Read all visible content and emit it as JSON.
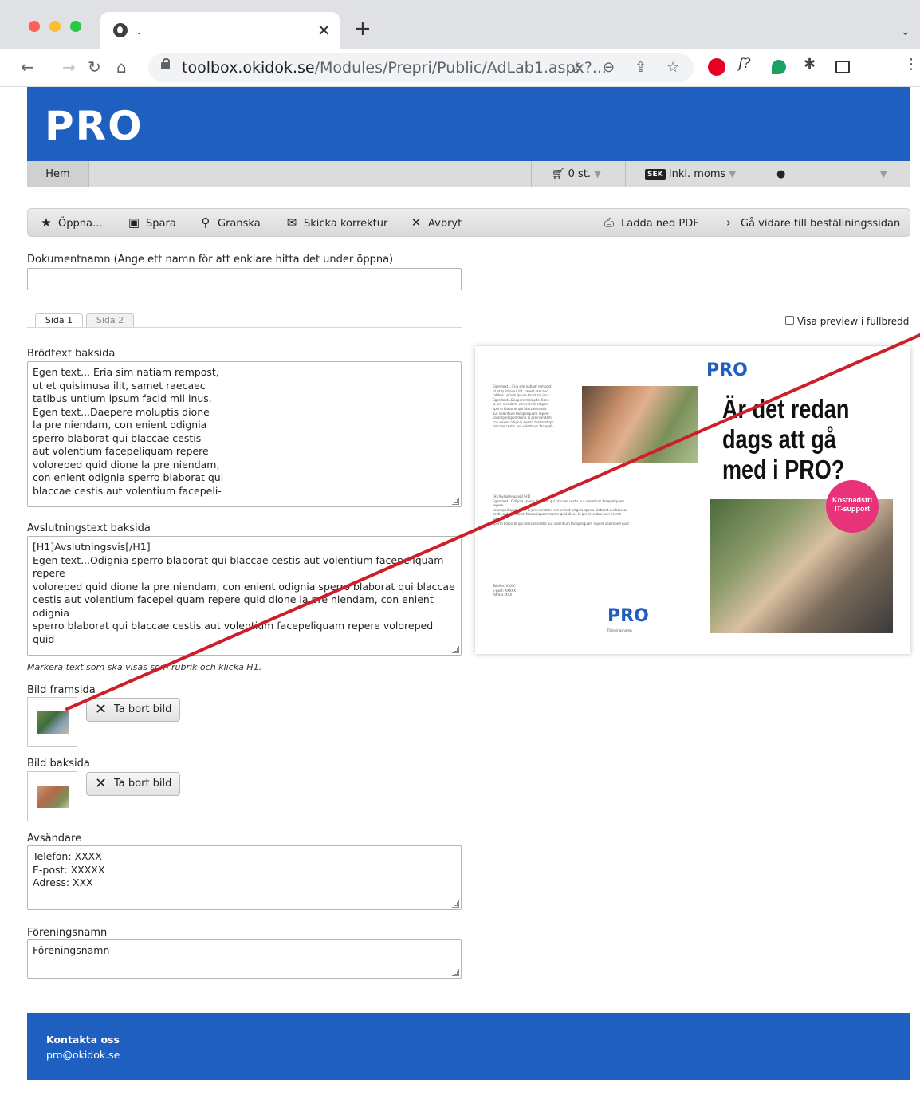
{
  "browser": {
    "tab_title": ".",
    "url_host": "toolbox.okidok.se",
    "url_path": "/Modules/Prepri/Public/AdLab1.aspx?..."
  },
  "header": {
    "logo": "PRO"
  },
  "menu": {
    "home": "Hem",
    "cart": "0 st.",
    "currency_badge": "SEK",
    "vat": "Inkl. moms"
  },
  "actions": {
    "open": "Öppna...",
    "save": "Spara",
    "review": "Granska",
    "send_proof": "Skicka korrektur",
    "cancel": "Avbryt",
    "download_pdf": "Ladda ned PDF",
    "go_order": "Gå vidare till beställningssidan"
  },
  "form": {
    "doc_name_label": "Dokumentnamn (Ange ett namn för att enklare hitta det under öppna)",
    "doc_name_value": "",
    "tabs": [
      "Sida 1",
      "Sida 2"
    ],
    "preview_full_label": "Visa preview i fullbredd",
    "body_label": "Brödtext baksida",
    "body_text": "Egen text... Eria sim natiam rempost,\nut et quisimusa ilit, samet raecaec\ntatibus untium ipsum facid mil inus.\nEgen text...Daepere moluptis dione\nla pre niendam, con enient odignia\nsperro blaborat qui blaccae cestis\naut volentium facepeliquam repere\nvoloreped quid dione la pre niendam,\ncon enient odignia sperro blaborat qui\nblaccae cestis aut volentium facepeli-",
    "closing_label": "Avslutningstext baksida",
    "closing_text": "[H1]Avslutningsvis[/H1]\nEgen text...Odignia sperro blaborat qui blaccae cestis aut volentium facepeliquam\nrepere\nvoloreped quid dione la pre niendam, con enient odignia sperro blaborat qui blaccae\ncestis aut volentium facepeliquam repere quid dione la pre niendam, con enient\nodignia\nsperro blaborat qui blaccae cestis aut volentium facepeliquam repere voloreped quid",
    "hint": "Markera text som ska visas som rubrik och klicka H1.",
    "front_image_label": "Bild framsida",
    "back_image_label": "Bild baksida",
    "remove_image": "Ta bort bild",
    "sender_label": "Avsändare",
    "sender_text": "Telefon: XXXX\nE-post: XXXXX\nAdress: XXX",
    "assoc_label": "Föreningsnamn",
    "assoc_text": "Föreningsnamn"
  },
  "preview": {
    "logo_top": "PRO",
    "headline": "Är det redan\ndags att gå\nmed i PRO?",
    "badge": "Kostnadsfri\nIT-support",
    "logo_bottom": "PRO",
    "logo_bottom_sub": "Föreningsnamn"
  },
  "footer": {
    "heading": "Kontakta oss",
    "email": "pro@okidok.se"
  }
}
